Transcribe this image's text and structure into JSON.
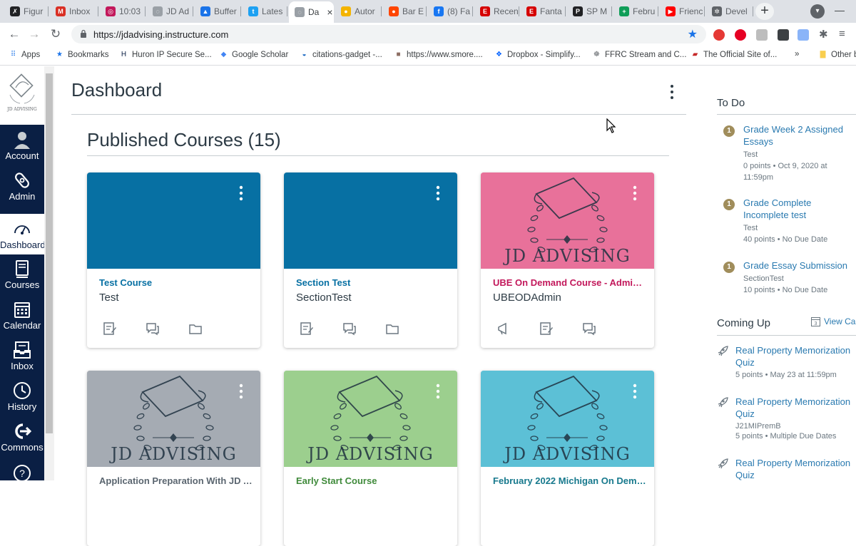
{
  "browser": {
    "tabs": [
      {
        "label": "Figur",
        "fav_color": "#202124",
        "fav_char": "✗"
      },
      {
        "label": "Inbox",
        "fav_color": "#d93025",
        "fav_char": "M"
      },
      {
        "label": "10:03",
        "fav_color": "#c2185b",
        "fav_char": "◎"
      },
      {
        "label": "JD Ad",
        "fav_color": "#9aa0a6",
        "fav_char": "◌"
      },
      {
        "label": "Buffer",
        "fav_color": "#1a73e8",
        "fav_char": "▲"
      },
      {
        "label": "Lates",
        "fav_color": "#1da1f2",
        "fav_char": "t"
      },
      {
        "label": "Da",
        "fav_color": "#9aa0a6",
        "fav_char": "◌",
        "active": true
      },
      {
        "label": "Autor",
        "fav_color": "#f4b400",
        "fav_char": "●"
      },
      {
        "label": "Bar E",
        "fav_color": "#ff4500",
        "fav_char": "●"
      },
      {
        "label": "(8) Fa",
        "fav_color": "#1877f2",
        "fav_char": "f"
      },
      {
        "label": "Recen",
        "fav_color": "#d50000",
        "fav_char": "E"
      },
      {
        "label": "Fanta",
        "fav_color": "#d50000",
        "fav_char": "E"
      },
      {
        "label": "SP M",
        "fav_color": "#202124",
        "fav_char": "P"
      },
      {
        "label": "Febru",
        "fav_color": "#0f9d58",
        "fav_char": "+"
      },
      {
        "label": "Frienc",
        "fav_color": "#ff0000",
        "fav_char": "▶"
      },
      {
        "label": "Devel",
        "fav_color": "#5f6368",
        "fav_char": "✲"
      }
    ],
    "url": "https://jdadvising.instructure.com",
    "bookmarks": [
      {
        "label": "Apps",
        "icon": "apps-grid-icon"
      },
      {
        "label": "Bookmarks",
        "icon": "star-icon"
      },
      {
        "label": "Huron IP Secure Se...",
        "icon": "huron-icon"
      },
      {
        "label": "Google Scholar",
        "icon": "scholar-icon"
      },
      {
        "label": "citations-gadget -...",
        "icon": "gadget-icon"
      },
      {
        "label": "https://www.smore....",
        "icon": "smore-icon"
      },
      {
        "label": "Dropbox - Simplify...",
        "icon": "dropbox-icon"
      },
      {
        "label": "FFRC Stream and C...",
        "icon": "ffrc-icon"
      },
      {
        "label": "The Official Site of...",
        "icon": "mlb-icon"
      },
      {
        "label": "»",
        "icon": ""
      },
      {
        "label": "Other b",
        "icon": "folder-icon"
      }
    ]
  },
  "nav": {
    "logo_text": "JD ADVISING",
    "items": [
      {
        "label": "Account",
        "icon": "account-icon"
      },
      {
        "label": "Admin",
        "icon": "admin-icon"
      },
      {
        "label": "Dashboard",
        "icon": "dashboard-icon",
        "active": true
      },
      {
        "label": "Courses",
        "icon": "courses-icon"
      },
      {
        "label": "Calendar",
        "icon": "calendar-icon"
      },
      {
        "label": "Inbox",
        "icon": "inbox-icon"
      },
      {
        "label": "History",
        "icon": "history-icon"
      },
      {
        "label": "Commons",
        "icon": "commons-icon"
      },
      {
        "label": "?",
        "icon": "help-icon"
      }
    ]
  },
  "main": {
    "title": "Dashboard",
    "section_title": "Published Courses (15)",
    "cards": [
      {
        "title": "Test Course",
        "subtitle": "Test",
        "hero": "solid",
        "color": "#0770a3",
        "title_color": "#0770a3",
        "actions": [
          "assignments-icon",
          "discussions-icon",
          "files-icon"
        ]
      },
      {
        "title": "Section Test",
        "subtitle": "SectionTest",
        "hero": "solid",
        "color": "#0770a3",
        "title_color": "#0770a3",
        "actions": [
          "assignments-icon",
          "discussions-icon",
          "files-icon"
        ]
      },
      {
        "title": "UBE On Demand Course - Admin ...",
        "subtitle": "UBEODAdmin",
        "hero": "logo",
        "color": "#e8719a",
        "title_color": "#c2185b",
        "actions": [
          "announcements-icon",
          "assignments-icon",
          "discussions-icon"
        ]
      },
      {
        "title": "Application Preparation With JD A...",
        "subtitle": "",
        "hero": "logo",
        "color": "#a5abb3",
        "title_color": "#5b6670",
        "actions": []
      },
      {
        "title": "Early Start Course",
        "subtitle": "",
        "hero": "logo",
        "color": "#9ccf8e",
        "title_color": "#3f8a3a",
        "actions": []
      },
      {
        "title": "February 2022 Michigan On Dema...",
        "subtitle": "",
        "hero": "logo",
        "color": "#5cc0d6",
        "title_color": "#17798d",
        "actions": []
      }
    ],
    "hero_logo_text": "JD ADVISING"
  },
  "todo": {
    "title": "To Do",
    "items": [
      {
        "badge": "1",
        "title": "Grade Week 2 Assigned Essays",
        "course": "Test",
        "detail": "0 points • Oct 9, 2020 at 11:59pm"
      },
      {
        "badge": "1",
        "title": "Grade Complete Incomplete test",
        "course": "Test",
        "detail": "40 points • No Due Date"
      },
      {
        "badge": "1",
        "title": "Grade Essay Submission",
        "course": "SectionTest",
        "detail": "10 points • No Due Date"
      }
    ]
  },
  "coming_up": {
    "title": "Coming Up",
    "view_calendar": "View Cal",
    "items": [
      {
        "title": "Real Property Memorization Quiz",
        "course": "",
        "detail": "5 points • May 23 at 11:59pm"
      },
      {
        "title": "Real Property Memorization Quiz",
        "course": "J21MIPremB",
        "detail": "5 points • Multiple Due Dates"
      },
      {
        "title": "Real Property Memorization Quiz",
        "course": "",
        "detail": ""
      }
    ]
  },
  "colors": {
    "nav_bg": "#0a1f44",
    "link": "#2a7ab0",
    "canvas_blue": "#0770a3",
    "badge": "#a08d5b"
  }
}
